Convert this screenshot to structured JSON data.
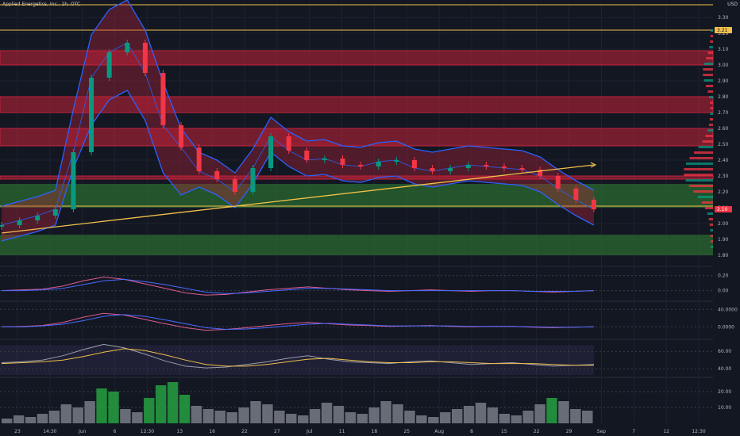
{
  "header": {
    "symbol_line": "Applied Energetics, Inc., 1h, OTC",
    "currency": "USD"
  },
  "colors": {
    "background": "#131722",
    "grid": "#1e2230",
    "axis_text": "#b2b5be",
    "red_zone": "#c2233a",
    "green_zone": "#2e7d32",
    "gold": "#f0c04a",
    "blue": "#2962ff",
    "up": "#089981",
    "down": "#f23645"
  },
  "chart_data": [
    {
      "type": "line",
      "panel": "price",
      "y_axis_ticks": [
        "3.30",
        "3.20",
        "3.10",
        "3.00",
        "2.90",
        "2.80",
        "2.70",
        "2.60",
        "2.50",
        "2.40",
        "2.30",
        "2.20",
        "2.10",
        "2.00",
        "1.90",
        "1.80"
      ],
      "ylim": [
        1.76,
        3.39
      ],
      "x_axis_ticks": [
        "23",
        "14:30",
        "Jun",
        "6",
        "12:30",
        "13",
        "16",
        "22",
        "27",
        "Jul",
        "11",
        "18",
        "25",
        "Aug",
        "8",
        "15",
        "22",
        "29",
        "Sep",
        "7",
        "12",
        "12:30"
      ],
      "badges": [
        {
          "label": "3.21",
          "value": 3.22
        },
        {
          "label": "2.10",
          "value": 2.09
        }
      ],
      "red_zones": [
        [
          3.0,
          3.09
        ],
        [
          2.7,
          2.8
        ],
        [
          2.49,
          2.6
        ],
        [
          2.28,
          2.3
        ]
      ],
      "green_zones": [
        [
          2.1,
          2.25
        ],
        [
          1.8,
          1.93
        ]
      ],
      "gold_levels": [
        3.38,
        3.22,
        2.11
      ],
      "gold_trend": {
        "from": [
          "19",
          1.94
        ],
        "to": [
          "29",
          2.37
        ]
      },
      "price_series": [
        {
          "x": "19",
          "close": 1.99
        },
        {
          "x": "23",
          "close": 2.02
        },
        {
          "x": "14:30",
          "close": 2.05
        },
        {
          "x": "Jun",
          "close": 2.09
        },
        {
          "x": "2",
          "close": 2.45
        },
        {
          "x": "5",
          "close": 2.92
        },
        {
          "x": "6",
          "close": 3.08
        },
        {
          "x": "8",
          "close": 3.14
        },
        {
          "x": "12:30",
          "close": 2.95
        },
        {
          "x": "13",
          "close": 2.62
        },
        {
          "x": "14",
          "close": 2.48
        },
        {
          "x": "16",
          "close": 2.33
        },
        {
          "x": "20",
          "close": 2.28
        },
        {
          "x": "22",
          "close": 2.2
        },
        {
          "x": "24",
          "close": 2.35
        },
        {
          "x": "27",
          "close": 2.55
        },
        {
          "x": "29",
          "close": 2.46
        },
        {
          "x": "Jul",
          "close": 2.4
        },
        {
          "x": "5",
          "close": 2.41
        },
        {
          "x": "11",
          "close": 2.37
        },
        {
          "x": "14",
          "close": 2.36
        },
        {
          "x": "18",
          "close": 2.39
        },
        {
          "x": "21",
          "close": 2.4
        },
        {
          "x": "25",
          "close": 2.35
        },
        {
          "x": "28",
          "close": 2.33
        },
        {
          "x": "Aug",
          "close": 2.35
        },
        {
          "x": "4",
          "close": 2.37
        },
        {
          "x": "8",
          "close": 2.36
        },
        {
          "x": "11",
          "close": 2.35
        },
        {
          "x": "15",
          "close": 2.34
        },
        {
          "x": "18",
          "close": 2.3
        },
        {
          "x": "22",
          "close": 2.22
        },
        {
          "x": "25",
          "close": 2.15
        },
        {
          "x": "29",
          "close": 2.09
        }
      ]
    },
    {
      "type": "line",
      "panel": "macd",
      "y_axis_ticks": [
        "0.20",
        "0.00"
      ],
      "ylim": [
        -0.12,
        0.28
      ],
      "series": [
        {
          "values": [
            0,
            0.01,
            0.02,
            0.06,
            0.13,
            0.18,
            0.15,
            0.09,
            0.03,
            -0.03,
            -0.06,
            -0.05,
            -0.02,
            0.01,
            0.03,
            0.05,
            0.03,
            0.01,
            0.0,
            -0.01,
            0.0,
            0.01,
            0.0,
            -0.01,
            0.0,
            0.0,
            -0.01,
            -0.02,
            -0.01,
            0.0
          ]
        },
        {
          "values": [
            0,
            0.0,
            0.01,
            0.03,
            0.08,
            0.13,
            0.15,
            0.12,
            0.08,
            0.03,
            -0.02,
            -0.04,
            -0.03,
            -0.01,
            0.01,
            0.03,
            0.03,
            0.02,
            0.01,
            0.0,
            0.0,
            0.0,
            0.0,
            0.0,
            0.0,
            0.0,
            -0.01,
            -0.01,
            -0.01,
            0.0
          ]
        }
      ]
    },
    {
      "type": "line",
      "panel": "oscillator",
      "y_axis_ticks": [
        "40.0000",
        "0.0000"
      ],
      "ylim": [
        -25,
        55
      ],
      "series": [
        {
          "values": [
            0,
            1,
            3,
            10,
            22,
            31,
            27,
            17,
            7,
            -2,
            -8,
            -6,
            -2,
            3,
            7,
            10,
            7,
            4,
            3,
            1,
            2,
            3,
            1,
            0,
            1,
            1,
            -1,
            -2,
            -1,
            0
          ]
        },
        {
          "values": [
            0,
            0,
            2,
            6,
            14,
            24,
            28,
            24,
            16,
            7,
            -2,
            -6,
            -5,
            -2,
            2,
            6,
            8,
            6,
            4,
            2,
            2,
            2,
            2,
            1,
            1,
            1,
            0,
            -1,
            -1,
            0
          ]
        }
      ]
    },
    {
      "type": "line",
      "panel": "rsi",
      "y_axis_ticks": [
        "60.00",
        "40.00"
      ],
      "ylim": [
        32,
        72
      ],
      "series": [
        {
          "values": [
            47,
            48,
            50,
            55,
            62,
            68,
            64,
            57,
            49,
            43,
            41,
            42,
            45,
            48,
            52,
            55,
            51,
            48,
            47,
            46,
            48,
            49,
            47,
            45,
            46,
            47,
            45,
            43,
            44,
            45
          ]
        },
        {
          "values": [
            46,
            47,
            48,
            50,
            54,
            59,
            63,
            61,
            56,
            50,
            45,
            43,
            43,
            45,
            48,
            51,
            52,
            50,
            48,
            47,
            47,
            48,
            48,
            47,
            46,
            46,
            46,
            45,
            44,
            44
          ]
        }
      ]
    },
    {
      "type": "bar",
      "panel": "volume",
      "y_axis_ticks": [
        "20.00",
        "10.00"
      ],
      "ylim": [
        0,
        28
      ],
      "values": [
        3,
        5,
        4,
        6,
        8,
        12,
        10,
        14,
        22,
        20,
        9,
        7,
        16,
        24,
        26,
        18,
        11,
        9,
        8,
        7,
        10,
        14,
        12,
        8,
        6,
        5,
        9,
        13,
        11,
        7,
        6,
        10,
        14,
        12,
        8,
        5,
        4,
        7,
        9,
        11,
        13,
        10,
        6,
        5,
        8,
        12,
        16,
        14,
        9,
        8
      ]
    }
  ]
}
